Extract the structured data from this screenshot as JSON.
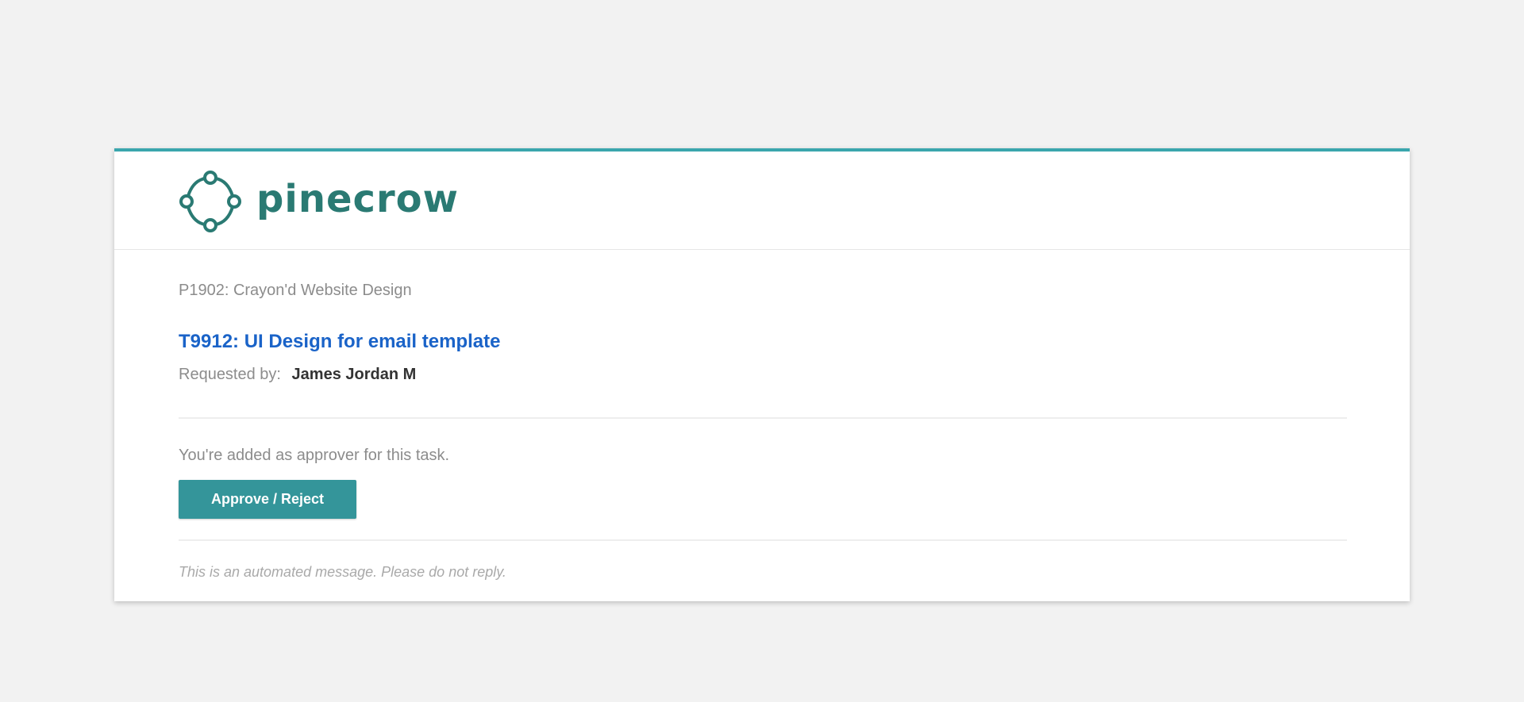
{
  "brand": {
    "name": "pinecrow",
    "color": "#2a7a73",
    "accent": "#3aa6ad"
  },
  "email": {
    "project": "P1902: Crayon'd Website Design",
    "task_title": "T9912: UI Design for email template",
    "requested_label": "Requested by:",
    "requester_name": "James Jordan M",
    "notice": "You're added as approver for this task.",
    "action_button": "Approve / Reject",
    "footer_note": "This is an automated message. Please do not reply."
  },
  "colors": {
    "page_background": "#f2f2f2",
    "link": "#1a63c8",
    "button": "#34959a",
    "muted_text": "#8c8c8c"
  }
}
